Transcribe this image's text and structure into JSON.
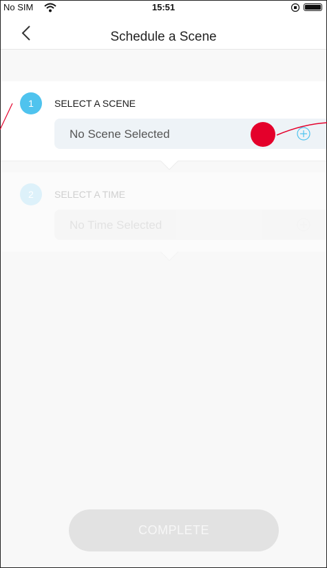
{
  "status_bar": {
    "carrier": "No SIM",
    "time": "15:51"
  },
  "nav": {
    "title": "Schedule a Scene"
  },
  "steps": [
    {
      "number": "1",
      "label": "SELECT A SCENE",
      "field_value": "No Scene Selected"
    },
    {
      "number": "2",
      "label": "SELECT A TIME",
      "field_value": "No Time Selected"
    }
  ],
  "complete_label": "COMPLETE",
  "icons": [
    "wifi-icon",
    "orientation-lock-icon",
    "battery-icon",
    "back-chevron-icon",
    "plus-circle-icon"
  ],
  "colors": {
    "accent": "#4fc3ee",
    "annotation": "#e4002b"
  }
}
